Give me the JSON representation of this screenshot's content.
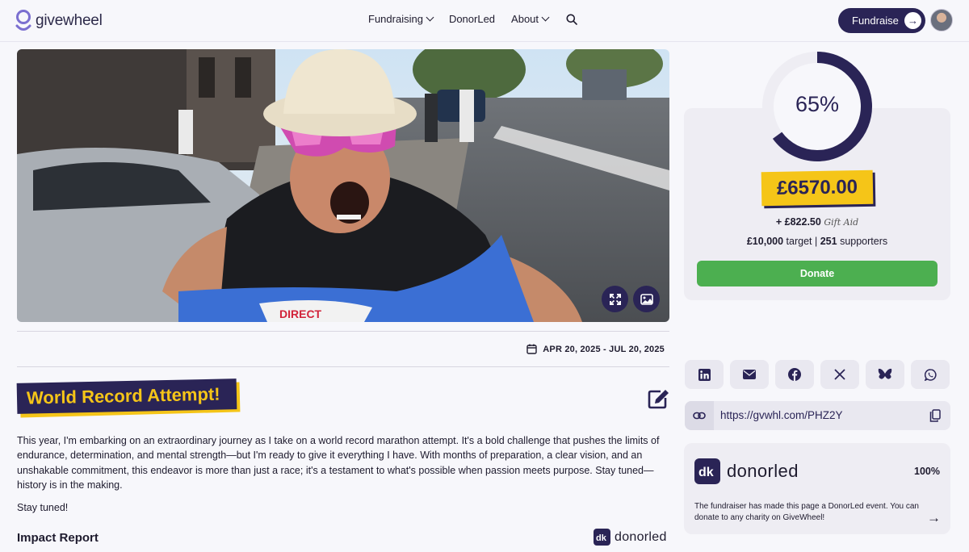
{
  "header": {
    "logo_text": "givewheel",
    "nav": [
      {
        "label": "Fundraising",
        "has_dropdown": true
      },
      {
        "label": "DonorLed",
        "has_dropdown": false
      },
      {
        "label": "About",
        "has_dropdown": true
      }
    ],
    "fundraise_label": "Fundraise"
  },
  "event": {
    "dates": "APR 20, 2025 - JUL 20, 2025",
    "title": "World Record Attempt!",
    "description": "This year, I'm embarking on an extraordinary journey as I take on a world record marathon attempt. It's a bold challenge that pushes the limits of endurance, determination, and mental strength—but I'm ready to give it everything I have. With months of preparation, a clear vision, and an unshakable commitment, this endeavor is more than just a race; it's a testament to what's possible when passion meets purpose. Stay tuned—history is in the making.",
    "description_2": "Stay tuned!",
    "impact_heading": "Impact Report",
    "impact_logo": "donorled"
  },
  "progress": {
    "percent_label": "65%",
    "percent_value": 65,
    "amount": "£6570.00",
    "gift_aid_amount": "+ £822.50",
    "gift_aid_label": "Gift Aid",
    "target": "£10,000",
    "target_suffix": "target",
    "supporters_count": "251",
    "supporters_label": "supporters",
    "donate_label": "Donate"
  },
  "share": {
    "buttons": [
      "linkedin-icon",
      "email-icon",
      "facebook-icon",
      "x-icon",
      "bluesky-icon",
      "whatsapp-icon"
    ],
    "url": "https://gvwhl.com/PHZ2Y"
  },
  "donorled_card": {
    "logo": "donorled",
    "percent": "100%",
    "text": "The fundraiser has made this page a DonorLed event. You can donate to any charity on GiveWheel!"
  },
  "colors": {
    "brand": "#2a2456",
    "accent": "#f5c518",
    "donate": "#4caf50",
    "background": "#f7f7fb"
  }
}
